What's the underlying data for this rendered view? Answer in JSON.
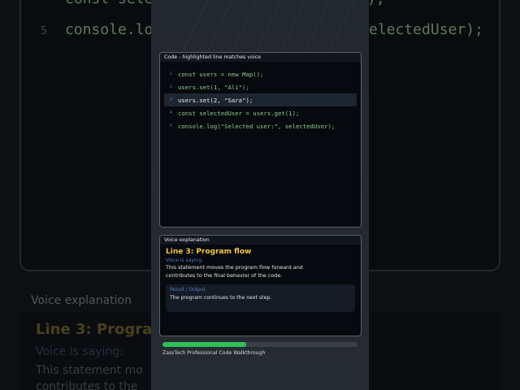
{
  "code_panel": {
    "header": "Code - highlighted line matches voice",
    "highlighted_line": 3,
    "lines": [
      {
        "n": "1",
        "code": "const users = new Map();"
      },
      {
        "n": "2",
        "code": "users.set(1, \"Ali\");"
      },
      {
        "n": "3",
        "code": "users.set(2, \"Sara\");"
      },
      {
        "n": "4",
        "code": "const selectedUser = users.get(1);"
      },
      {
        "n": "5",
        "code": "console.log(\"Selected user:\", selectedUser);"
      }
    ]
  },
  "voice_panel": {
    "header": "Voice explanation",
    "title": "Line 3: Program flow",
    "subtitle": "Voice is saying:",
    "description": "This statement moves the program flow forward and contributes to the final behavior of the code.",
    "result_label": "Result / Output",
    "result_text": "The program continues to the next step."
  },
  "progress": {
    "fraction": 0.43
  },
  "footer": "ZassTech Professional Code Walkthrough",
  "background": {
    "line_a_code": "const sele",
    "line_a_tail": ");",
    "line_b_num": "5",
    "line_b_code": "console.lo",
    "line_b_tail": "electedUser);",
    "voice_header": "Voice explanation",
    "title": "Line 3: Progra",
    "subtitle": "Voice is saying:",
    "desc_1": "This statement mo",
    "desc_2": "contributes to the"
  },
  "colors": {
    "accent_title": "#f2c744",
    "code_text": "#8fd08a",
    "progress": "#2fbf5b",
    "label_blue": "#4b78c8"
  }
}
